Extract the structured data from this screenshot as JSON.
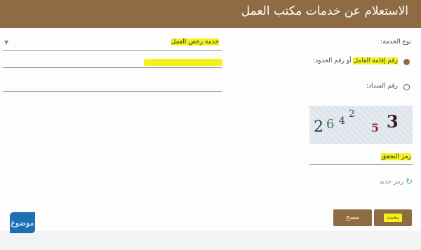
{
  "header": {
    "title": "الاستعلام عن خدمات مكتب العمل"
  },
  "form": {
    "service_type_label": "نوع الخدمة:",
    "service_select_value": "خدمة رخص العمل",
    "radio_options": [
      {
        "label_highlighted": "رقم إقامة العامل",
        "label_rest": " أو رقم الحدود:",
        "selected": true
      },
      {
        "label": "رقم السداد:",
        "selected": false
      }
    ],
    "captcha": {
      "chars": [
        "2",
        "6",
        "4",
        "2",
        "5",
        "3"
      ]
    },
    "captcha_field_placeholder": "رمز التحقق",
    "refresh_label": "رمز جديد",
    "search_button": "بحث",
    "clear_button": "مسح"
  },
  "logo": {
    "text": "موضوع"
  },
  "colors": {
    "brand": "#8f6b43",
    "highlight": "#f4f21a",
    "refresh_icon": "#4caf50"
  }
}
